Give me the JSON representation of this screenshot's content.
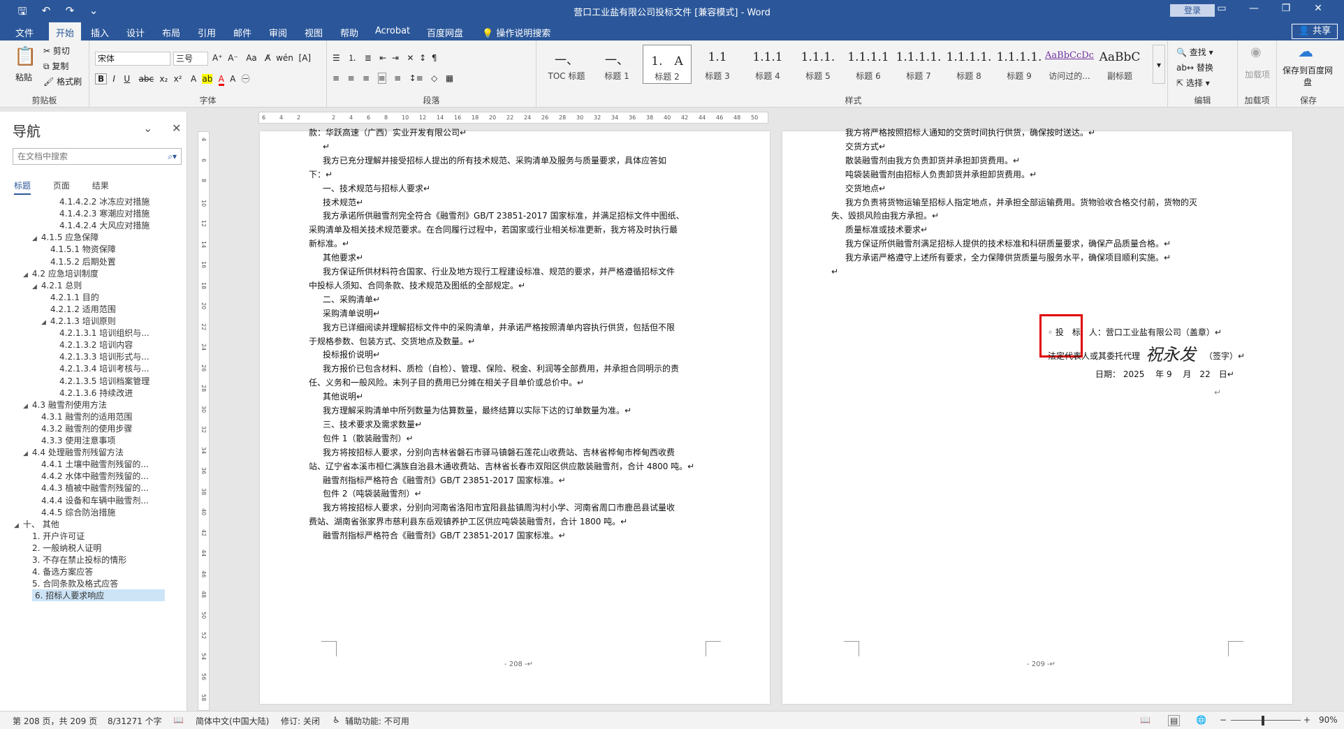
{
  "titlebar": {
    "title": "营口工业盐有限公司投标文件 [兼容模式] - Word",
    "login": "登录",
    "share": "共享"
  },
  "menu": [
    "文件",
    "开始",
    "插入",
    "设计",
    "布局",
    "引用",
    "邮件",
    "审阅",
    "视图",
    "帮助",
    "Acrobat",
    "百度网盘",
    "操作说明搜索"
  ],
  "ribbon": {
    "clipboard": {
      "paste": "粘贴",
      "cut": "剪切",
      "copy": "复制",
      "format_painter": "格式刷",
      "label": "剪贴板"
    },
    "font": {
      "name": "宋体",
      "size": "三号",
      "label": "字体"
    },
    "paragraph": {
      "label": "段落"
    },
    "styles": {
      "label": "样式",
      "items": [
        {
          "preview": "一、",
          "name": "TOC 标题"
        },
        {
          "preview": "一、",
          "name": "标题 1"
        },
        {
          "preview": "1.　A",
          "name": "标题 2"
        },
        {
          "preview": "1.1",
          "name": "标题 3"
        },
        {
          "preview": "1.1.1",
          "name": "标题 4"
        },
        {
          "preview": "1.1.1.",
          "name": "标题 5"
        },
        {
          "preview": "1.1.1.1",
          "name": "标题 6"
        },
        {
          "preview": "1.1.1.1.",
          "name": "标题 7"
        },
        {
          "preview": "1.1.1.1.",
          "name": "标题 8"
        },
        {
          "preview": "1.1.1.1.",
          "name": "标题 9"
        },
        {
          "preview": "AaBbCcDc",
          "name": "访问过的..."
        },
        {
          "preview": "AaBbC",
          "name": "副标题"
        }
      ]
    },
    "editing": {
      "find": "查找",
      "replace": "替换",
      "select": "选择",
      "label": "编辑"
    },
    "addins": {
      "add": "加载项",
      "label": "加载项"
    },
    "save": {
      "save_to": "保存到百度网盘",
      "label": "保存"
    }
  },
  "nav": {
    "title": "导航",
    "search_placeholder": "在文档中搜索",
    "tabs": [
      "标题",
      "页面",
      "结果"
    ],
    "items": [
      {
        "text": "4.1.4.2.2 冰冻应对措施",
        "indent": 4,
        "toggle": ""
      },
      {
        "text": "4.1.4.2.3 寒潮应对措施",
        "indent": 4,
        "toggle": ""
      },
      {
        "text": "4.1.4.2.4 大风应对措施",
        "indent": 4,
        "toggle": ""
      },
      {
        "text": "4.1.5 应急保障",
        "indent": 2,
        "toggle": "◢"
      },
      {
        "text": "4.1.5.1 物资保障",
        "indent": 3,
        "toggle": ""
      },
      {
        "text": "4.1.5.2 后期处置",
        "indent": 3,
        "toggle": ""
      },
      {
        "text": "4.2 应急培训制度",
        "indent": 1,
        "toggle": "◢"
      },
      {
        "text": "4.2.1 总则",
        "indent": 2,
        "toggle": "◢"
      },
      {
        "text": "4.2.1.1 目的",
        "indent": 3,
        "toggle": ""
      },
      {
        "text": "4.2.1.2 适用范围",
        "indent": 3,
        "toggle": ""
      },
      {
        "text": "4.2.1.3 培训原则",
        "indent": 3,
        "toggle": "◢"
      },
      {
        "text": "4.2.1.3.1 培训组织与...",
        "indent": 4,
        "toggle": ""
      },
      {
        "text": "4.2.1.3.2 培训内容",
        "indent": 4,
        "toggle": ""
      },
      {
        "text": "4.2.1.3.3 培训形式与...",
        "indent": 4,
        "toggle": ""
      },
      {
        "text": "4.2.1.3.4 培训考核与...",
        "indent": 4,
        "toggle": ""
      },
      {
        "text": "4.2.1.3.5 培训档案管理",
        "indent": 4,
        "toggle": ""
      },
      {
        "text": "4.2.1.3.6 持续改进",
        "indent": 4,
        "toggle": ""
      },
      {
        "text": "4.3 融雪剂使用方法",
        "indent": 1,
        "toggle": "◢"
      },
      {
        "text": "4.3.1 融雪剂的适用范围",
        "indent": 2,
        "toggle": ""
      },
      {
        "text": "4.3.2 融雪剂的使用步骤",
        "indent": 2,
        "toggle": ""
      },
      {
        "text": "4.3.3 使用注意事项",
        "indent": 2,
        "toggle": ""
      },
      {
        "text": "4.4 处理融雪剂残留方法",
        "indent": 1,
        "toggle": "◢"
      },
      {
        "text": "4.4.1 土壤中融雪剂残留的...",
        "indent": 2,
        "toggle": ""
      },
      {
        "text": "4.4.2 水体中融雪剂残留的...",
        "indent": 2,
        "toggle": ""
      },
      {
        "text": "4.4.3 植被中融雪剂残留的...",
        "indent": 2,
        "toggle": ""
      },
      {
        "text": "4.4.4 设备和车辆中融雪剂...",
        "indent": 2,
        "toggle": ""
      },
      {
        "text": "4.4.5 综合防治措施",
        "indent": 2,
        "toggle": ""
      },
      {
        "text": "十、 其他",
        "indent": 0,
        "toggle": "◢"
      },
      {
        "text": "1. 开户许可证",
        "indent": 1,
        "toggle": ""
      },
      {
        "text": "2. 一般纳税人证明",
        "indent": 1,
        "toggle": ""
      },
      {
        "text": "3. 不存在禁止投标的情形",
        "indent": 1,
        "toggle": ""
      },
      {
        "text": "4. 备选方案应答",
        "indent": 1,
        "toggle": ""
      },
      {
        "text": "5. 合同条款及格式应答",
        "indent": 1,
        "toggle": ""
      },
      {
        "text": "6. 招标人要求响应",
        "indent": 1,
        "toggle": "",
        "selected": true
      }
    ]
  },
  "page208": {
    "lines": [
      "款：华跃高速（广西）实业开发有限公司↵",
      "↵",
      "我方已充分理解并接受招标人提出的所有技术规范、采购清单及服务与质量要求，具体应答如",
      "下：↵",
      "一、技术规范与招标人要求↵",
      "技术规范↵",
      "我方承诺所供融雪剂完全符合《融雪剂》GB/T 23851-2017 国家标准，并满足招标文件中图纸、",
      "采购清单及相关技术规范要求。在合同履行过程中，若国家或行业相关标准更新，我方将及时执行最",
      "新标准。↵",
      "其他要求↵",
      "我方保证所供材料符合国家、行业及地方现行工程建设标准、规范的要求，并严格遵循招标文件",
      "中投标人须知、合同条款、技术规范及图纸的全部规定。↵",
      "二、采购清单↵",
      "采购清单说明↵",
      "我方已详细阅读并理解招标文件中的采购清单，并承诺严格按照清单内容执行供货，包括但不限",
      "于规格参数、包装方式、交货地点及数量。↵",
      "投标报价说明↵",
      "我方报价已包含材料、质检（自检）、管理、保险、税金、利润等全部费用，并承担合同明示的责",
      "任、义务和一般风险。未列子目的费用已分摊在相关子目单价或总价中。↵",
      "其他说明↵",
      "我方理解采购清单中所列数量为估算数量，最终结算以实际下达的订单数量为准。↵",
      "三、技术要求及需求数量↵",
      "包件 1（散装融雪剂）↵",
      "我方将按招标人要求，分别向吉林省磐石市驿马镇磐石莲花山收费站、吉林省桦甸市桦甸西收费",
      "站、辽宁省本溪市桓仁满族自治县木通收费站、吉林省长春市双阳区供应散装融雪剂，合计 4800 吨。↵",
      "融雪剂指标严格符合《融雪剂》GB/T 23851-2017 国家标准。↵",
      "包件 2（吨袋装融雪剂）↵",
      "我方将按招标人要求，分别向河南省洛阳市宜阳县盐镇周沟村小学、河南省周口市鹿邑县试量收",
      "费站、湖南省张家界市慈利县东岳观镇养护工区供应吨袋装融雪剂，合计 1800 吨。↵",
      "融雪剂指标严格符合《融雪剂》GB/T 23851-2017 国家标准。↵"
    ],
    "page_number": "- 208 -↵"
  },
  "page209": {
    "lines": [
      "我方将严格按照招标人通知的交货时间执行供货，确保按时送达。↵",
      "交货方式↵",
      "散装融雪剂由我方负责卸货并承担卸货费用。↵",
      "吨袋装融雪剂由招标人负责卸货并承担卸货费用。↵",
      "交货地点↵",
      "我方负责将货物运输至招标人指定地点，并承担全部运输费用。货物验收合格交付前，货物的灭",
      "失、毁损风险由我方承担。↵",
      "质量标准或技术要求↵",
      "我方保证所供融雪剂满足招标人提供的技术标准和科研质量要求，确保产品质量合格。↵",
      "我方承诺严格遵守上述所有要求，全力保障供货质量与服务水平，确保项目顺利实施。↵",
      "↵"
    ],
    "bidder": "◦ 投　标　人：营口工业盐有限公司（盖章）↵",
    "rep_label": "法定代表人或其委托代理",
    "signature": "祝永发",
    "sign_suffix": "（签字）↵",
    "date": "日期：  2025　 年 9 　月　22　日↵",
    "end_mark": "↵",
    "page_number": "- 209 -↵"
  },
  "statusbar": {
    "page": "第 208 页，共 209 页",
    "words": "8/31271 个字",
    "lang": "简体中文(中国大陆)",
    "track": "修订: 关闭",
    "access": "辅助功能: 不可用",
    "zoom": "90%"
  },
  "colors": {
    "accent": "#2b579a",
    "highlight": "#e00000"
  }
}
